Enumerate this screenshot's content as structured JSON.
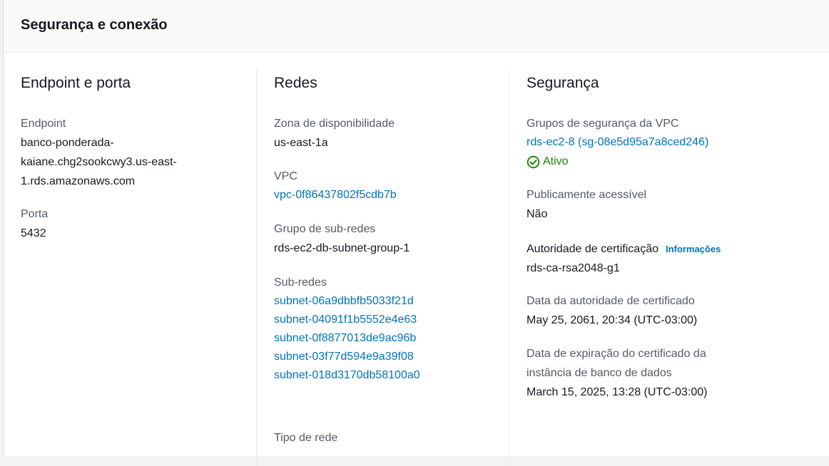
{
  "section": {
    "title": "Segurança e conexão"
  },
  "endpoint_port": {
    "title": "Endpoint e porta",
    "endpoint_label": "Endpoint",
    "endpoint_lines": [
      "banco-ponderada-",
      "kaiane.chg2sookcwy3.us-east-",
      "1.rds.amazonaws.com"
    ],
    "port_label": "Porta",
    "port_value": "5432"
  },
  "networks": {
    "title": "Redes",
    "az_label": "Zona de disponibilidade",
    "az_value": "us-east-1a",
    "vpc_label": "VPC",
    "vpc_value": "vpc-0f86437802f5cdb7b",
    "subnet_group_label": "Grupo de sub-redes",
    "subnet_group_value": "rds-ec2-db-subnet-group-1",
    "subnets_label": "Sub-redes",
    "subnets": [
      "subnet-06a9dbbfb5033f21d",
      "subnet-04091f1b5552e4e63",
      "subnet-0f8877013de9ac96b",
      "subnet-03f77d594e9a39f08",
      "subnet-018d3170db58100a0"
    ],
    "network_type_label": "Tipo de rede"
  },
  "security": {
    "title": "Segurança",
    "vpc_sg_label": "Grupos de segurança da VPC",
    "vpc_sg_value": "rds-ec2-8 (sg-08e5d95a7a8ced246)",
    "vpc_sg_status": "Ativo",
    "status_icon": "check-circle-icon",
    "status_color": "#1d8102",
    "public_label": "Publicamente acessível",
    "public_value": "Não",
    "ca_label": "Autoridade de certificação",
    "ca_info_link": "Informações",
    "ca_value": "rds-ca-rsa2048-g1",
    "ca_date_label": "Data da autoridade de certificado",
    "ca_date_value": "May 25, 2061, 20:34 (UTC-03:00)",
    "cert_expiry_label_lines": [
      "Data de expiração do certificado da",
      "instância de banco de dados"
    ],
    "cert_expiry_value": "March 15, 2025, 13:28 (UTC-03:00)"
  },
  "colors": {
    "link": "#0073bb",
    "label": "#545b64",
    "text": "#16191f"
  }
}
